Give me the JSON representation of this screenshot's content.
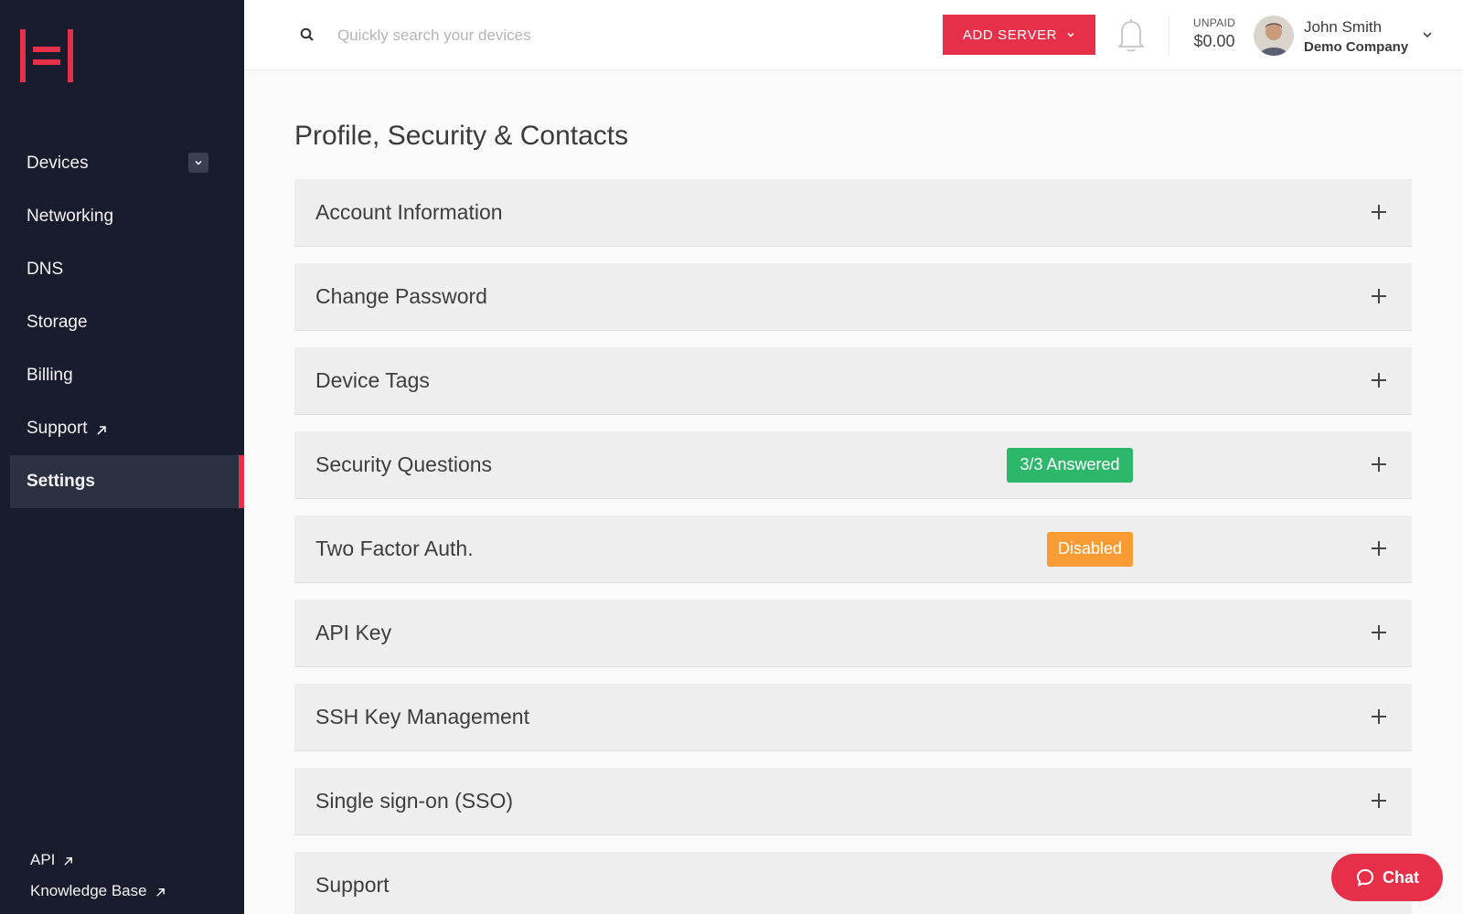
{
  "sidebar": {
    "items": [
      {
        "label": "Devices"
      },
      {
        "label": "Networking"
      },
      {
        "label": "DNS"
      },
      {
        "label": "Storage"
      },
      {
        "label": "Billing"
      },
      {
        "label": "Support"
      },
      {
        "label": "Settings"
      }
    ],
    "active": "Settings",
    "footer": [
      {
        "label": "API"
      },
      {
        "label": "Knowledge Base"
      }
    ]
  },
  "topbar": {
    "search_placeholder": "Quickly search your devices",
    "add_server_label": "ADD SERVER",
    "unpaid_label": "UNPAID",
    "unpaid_value": "$0.00",
    "user_name": "John Smith",
    "company": "Demo Company"
  },
  "main": {
    "title": "Profile, Security & Contacts",
    "panels": [
      {
        "title": "Account Information"
      },
      {
        "title": "Change Password"
      },
      {
        "title": "Device Tags"
      },
      {
        "title": "Security Questions",
        "badge": "3/3 Answered"
      },
      {
        "title": "Two Factor Auth.",
        "badge": "Disabled"
      },
      {
        "title": "API Key"
      },
      {
        "title": "SSH Key Management"
      },
      {
        "title": "Single sign-on (SSO)"
      },
      {
        "title": "Support"
      }
    ]
  },
  "chat": {
    "label": "Chat"
  },
  "colors": {
    "accent": "#e6304a",
    "sidebar_bg": "#181c2d",
    "badge_success": "#2db76b",
    "badge_warning": "#f99c33"
  },
  "icons": [
    "brand-logo-icon",
    "chevron-down-icon",
    "external-link-icon",
    "search-icon",
    "bell-icon",
    "plus-icon",
    "chat-bubble-icon"
  ]
}
